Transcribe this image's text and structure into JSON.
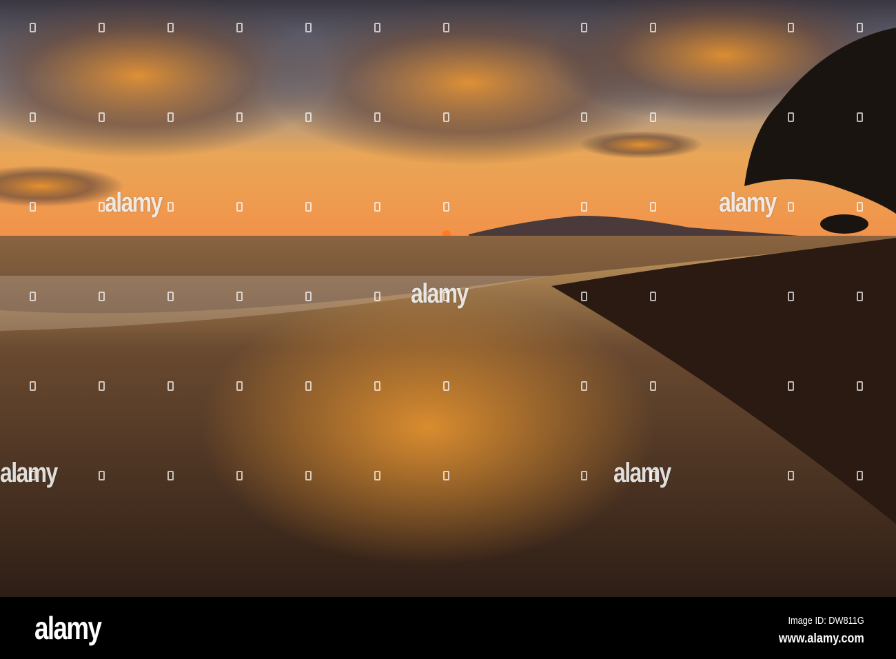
{
  "watermark": {
    "text": "alamy"
  },
  "footer": {
    "logo": "alamy",
    "image_id": "Image ID: DW811G",
    "website": "www.alamy.com"
  }
}
